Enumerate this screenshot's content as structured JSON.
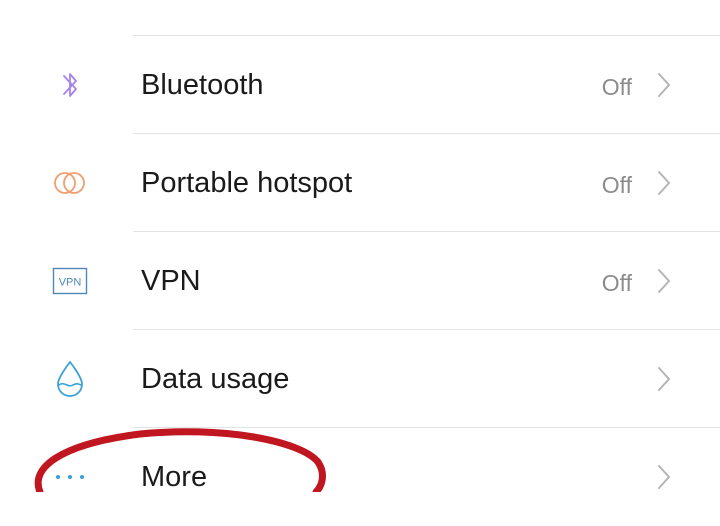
{
  "settings": {
    "items": [
      {
        "label": "Bluetooth",
        "value": "Off",
        "icon": "bluetooth-icon",
        "icon_color": "#a583e8"
      },
      {
        "label": "Portable hotspot",
        "value": "Off",
        "icon": "hotspot-icon",
        "icon_color": "#f0a070"
      },
      {
        "label": "VPN",
        "value": "Off",
        "icon": "vpn-icon",
        "icon_text": "VPN",
        "icon_color": "#4f88b8"
      },
      {
        "label": "Data usage",
        "value": "",
        "icon": "water-drop-icon",
        "icon_color": "#3aa0d8"
      },
      {
        "label": "More",
        "value": "",
        "icon": "more-dots-icon",
        "icon_color": "#3aa0d8"
      }
    ]
  },
  "annotation": {
    "shape": "ellipse",
    "color": "#c0161f",
    "target": "More"
  },
  "colors": {
    "background": "#ffffff",
    "divider": "#e3e3e3",
    "secondary_text": "#8c8c8c",
    "chevron": "#b5b5b5"
  }
}
